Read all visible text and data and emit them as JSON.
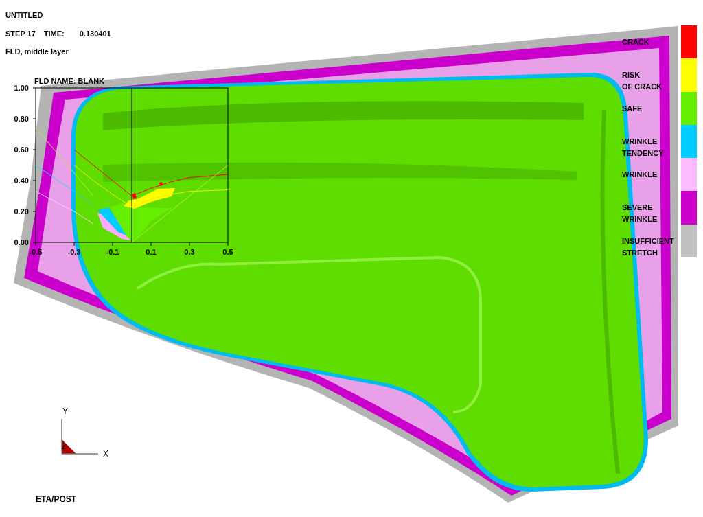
{
  "header": {
    "title": "UNTITLED",
    "step": "STEP 17",
    "time_label": "TIME:",
    "time_value": "0.130401",
    "result": "FLD, middle layer"
  },
  "fld": {
    "name": "FLD NAME: BLANK",
    "chart_data": {
      "type": "line",
      "x": [
        -0.5,
        -0.3,
        -0.2,
        -0.1,
        0,
        0.1,
        0.2,
        0.3,
        0.5
      ],
      "xlim": [
        -0.5,
        0.5
      ],
      "ylim": [
        0,
        1
      ],
      "xticks": [
        {
          "value": -0.5,
          "label": "-0.5"
        },
        {
          "value": -0.3,
          "label": "-0.3"
        },
        {
          "value": -0.1,
          "label": "-0.1"
        },
        {
          "value": 0.1,
          "label": "0.1"
        },
        {
          "value": 0.3,
          "label": "0.3"
        },
        {
          "value": 0.5,
          "label": "0.5"
        }
      ],
      "yticks": [
        {
          "value": 0,
          "label": "0.00"
        },
        {
          "value": 0.2,
          "label": "0.20"
        },
        {
          "value": 0.4,
          "label": "0.40"
        },
        {
          "value": 0.6,
          "label": "0.60"
        },
        {
          "value": 0.8,
          "label": "0.80"
        },
        {
          "value": 1,
          "label": "1.00"
        }
      ],
      "series": [
        {
          "color": "#ff0000",
          "values": [
            null,
            0.6,
            0.5,
            0.4,
            0.3,
            0.35,
            0.39,
            0.42,
            0.44
          ]
        },
        {
          "color": "#eeee00",
          "values": [
            null,
            0.5,
            0.4,
            0.31,
            0.23,
            0.28,
            0.31,
            0.33,
            0.34
          ]
        },
        {
          "color": "#b0f040",
          "values": [
            0.74,
            0.45,
            0.3,
            null,
            null,
            null,
            null,
            null,
            null
          ]
        },
        {
          "color": "#b0f040",
          "values": [
            null,
            null,
            null,
            null,
            0,
            0.1,
            0.2,
            0.3,
            0.5
          ]
        },
        {
          "color": "#33ccff",
          "values": [
            0.5,
            0.33,
            0.24,
            null,
            null,
            null,
            null,
            null,
            null
          ]
        },
        {
          "color": "#ffccff",
          "values": [
            0.33,
            0.2,
            0.12,
            null,
            null,
            null,
            null,
            null,
            null
          ]
        }
      ]
    }
  },
  "legend": [
    {
      "label": "CRACK",
      "color": "#ff0000"
    },
    {
      "label": "RISK\nOF CRACK",
      "color": "#ffff00"
    },
    {
      "label": "SAFE",
      "color": "#66ee00"
    },
    {
      "label": "WRINKLE\nTENDENCY",
      "color": "#00ccff"
    },
    {
      "label": "WRINKLE",
      "color": "#ffbbff"
    },
    {
      "label": "SEVERE\nWRINKLE",
      "color": "#cc00cc"
    },
    {
      "label": "INSUFFICIENT\nSTRETCH",
      "color": "#c0c0c0"
    }
  ],
  "triad": {
    "y": "Y",
    "x": "X",
    "z": "Z"
  },
  "footer": "ETA/POST"
}
